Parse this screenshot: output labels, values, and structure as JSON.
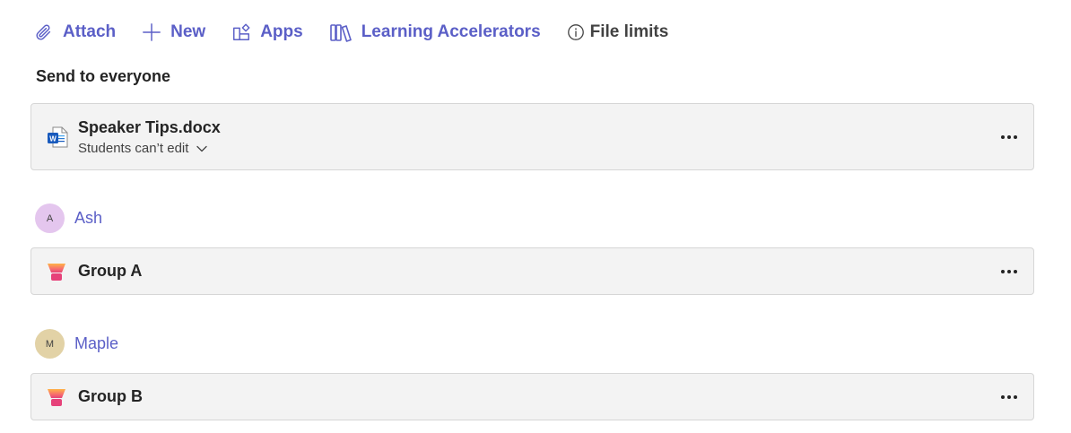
{
  "toolbar": {
    "attach": "Attach",
    "new": "New",
    "apps": "Apps",
    "learning_accelerators": "Learning Accelerators",
    "file_limits": "File limits"
  },
  "section_title": "Send to everyone",
  "file": {
    "name": "Speaker Tips.docx",
    "permission": "Students can’t edit",
    "icon": "word-doc-icon"
  },
  "students": [
    {
      "initial": "A",
      "name": "Ash",
      "avatar_color": "#e4c6ee",
      "group": "Group A"
    },
    {
      "initial": "M",
      "name": "Maple",
      "avatar_color": "#e2d2a6",
      "group": "Group B"
    }
  ],
  "colors": {
    "accent": "#5b5fc7",
    "card_background": "#f3f3f3",
    "card_border": "#d6d6d6"
  }
}
